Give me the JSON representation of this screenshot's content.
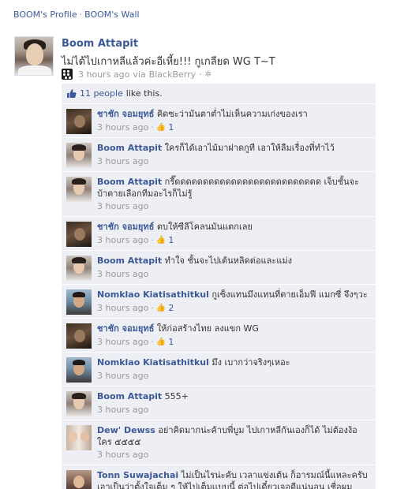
{
  "breadcrumb": {
    "profile": "BOOM's Profile",
    "separator": "·",
    "wall": "BOOM's Wall"
  },
  "post": {
    "author": "Boom Attapit",
    "text": "ไม่ได้ไปเกาหลีแล้วค่ะอีเหี้ย!!! กูเกลียด WG T~T",
    "time": "3 hours ago",
    "via": "via",
    "via_app": "BlackBerry",
    "separator": "·",
    "icons": {
      "device": "blackberry-icon",
      "settings": "gear-icon"
    }
  },
  "likes": {
    "count_text": "11 people",
    "suffix": "like this."
  },
  "comments": [
    {
      "author": "ชาชัก จอมยุทธ์",
      "text": "คิดซะว่ามันตาต่ำไม่เห็นความเก่งของเรา",
      "time": "3 hours ago",
      "likes": "1",
      "avatar": "chachak"
    },
    {
      "author": "Boom Attapit",
      "text": "ใครก็ได้เอาไม้มาฝาดกูที เอาให้ลืมเรื่องที่ทำไว้",
      "time": "3 hours ago",
      "likes": "",
      "avatar": "boom"
    },
    {
      "author": "Boom Attapit",
      "text": "กรี๊ดดดดดดดดดดดดดดดดดดดดดดดดดด เจ็บชั้นจะบ้าตายเลือกทีมอะไรก็ไม่รู้",
      "time": "3 hours ago",
      "likes": "",
      "avatar": "boom"
    },
    {
      "author": "ชาชัก จอมยุทธ์",
      "text": "ตบให้ซีลีโคลนมันแตกเลย",
      "time": "3 hours ago",
      "likes": "1",
      "avatar": "chachak"
    },
    {
      "author": "Boom Attapit",
      "text": "ทำใจ ชั้นจะไปเต้นหลิดต่อและแม่ง",
      "time": "3 hours ago",
      "likes": "",
      "avatar": "boom"
    },
    {
      "author": "Nomklao Kiatisathitkul",
      "text": "กูเซ็งแทนมึงแทนที่ตายเอ็มฟี แมกซี่ จึงๆวะ",
      "time": "3 hours ago",
      "likes": "2",
      "avatar": "nomklao"
    },
    {
      "author": "ชาชัก จอมยุทธ์",
      "text": "ให้ก่อสร้างไทย ลงแขก WG",
      "time": "3 hours ago",
      "likes": "1",
      "avatar": "chachak"
    },
    {
      "author": "Nomklao Kiatisathitkul",
      "text": "มึง เบากว่าจริงๆเหอะ",
      "time": "3 hours ago",
      "likes": "",
      "avatar": "nomklao"
    },
    {
      "author": "Boom Attapit",
      "text": "555+",
      "time": "3 hours ago",
      "likes": "",
      "avatar": "boom"
    },
    {
      "author": "Dew' Dewss",
      "text": "อย่าคิดมากน่ะค้าบพี่บูม ไปเกาหลีกันเองก็ได้ ไม่ต้องง้อใคร ๕๕๕๕",
      "time": "3 hours ago",
      "likes": "",
      "avatar": "dew"
    },
    {
      "author": "Tonn Suwajachai",
      "text": "ไม่เป็นไรน่ะคับ เวลาแข่งเต้น ก็อารมณ์นี้แหละครับ เอาเป็นว่าตั้งใจเต็ม ๆ ให้ไปเต็มเเบบนี้ ต่อไปเดี๋ยวเจอดีแน่นอน เชื่อผม",
      "time": "",
      "likes": "",
      "avatar": "tonn"
    }
  ],
  "icons": {
    "like": "thumbs-up-icon"
  }
}
